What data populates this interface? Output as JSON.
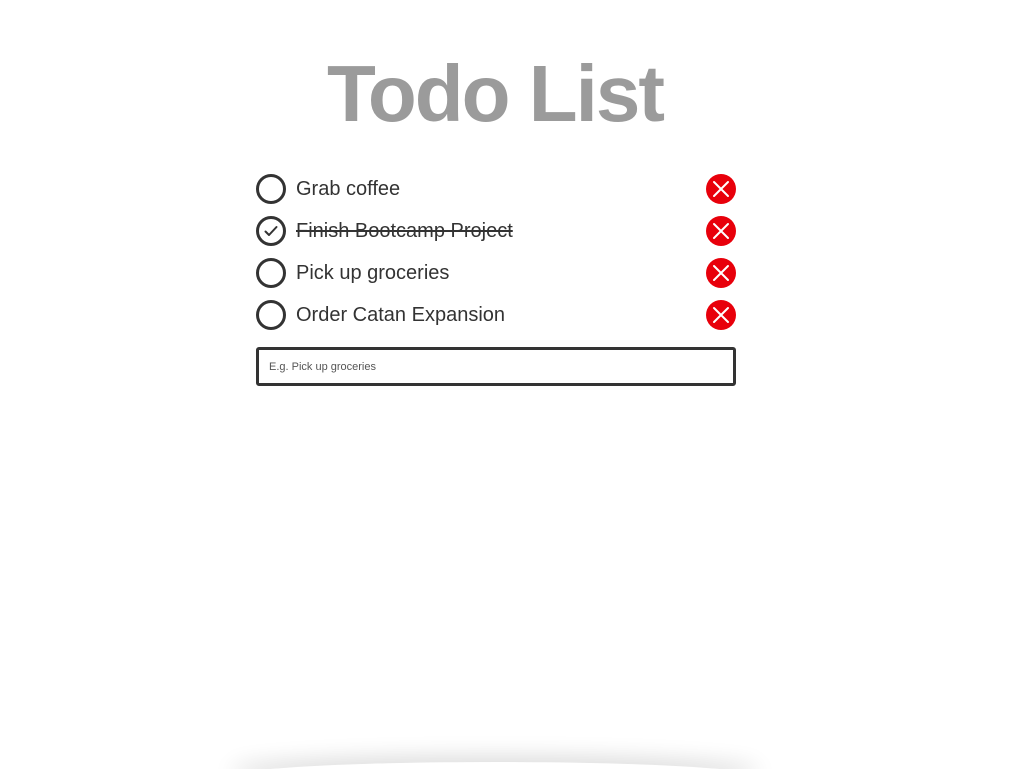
{
  "header": {
    "title": "Todo List"
  },
  "todos": [
    {
      "text": "Grab coffee",
      "completed": false
    },
    {
      "text": "Finish Bootcamp Project",
      "completed": true
    },
    {
      "text": "Pick up groceries",
      "completed": false
    },
    {
      "text": "Order Catan Expansion",
      "completed": false
    }
  ],
  "new_todo": {
    "value": "",
    "placeholder": "E.g. Pick up groceries"
  },
  "icons": {
    "check": "check-icon",
    "delete": "close-icon"
  },
  "colors": {
    "title": "#9b9b9b",
    "text": "#333333",
    "delete": "#e8000b",
    "background": "#ffffff"
  }
}
